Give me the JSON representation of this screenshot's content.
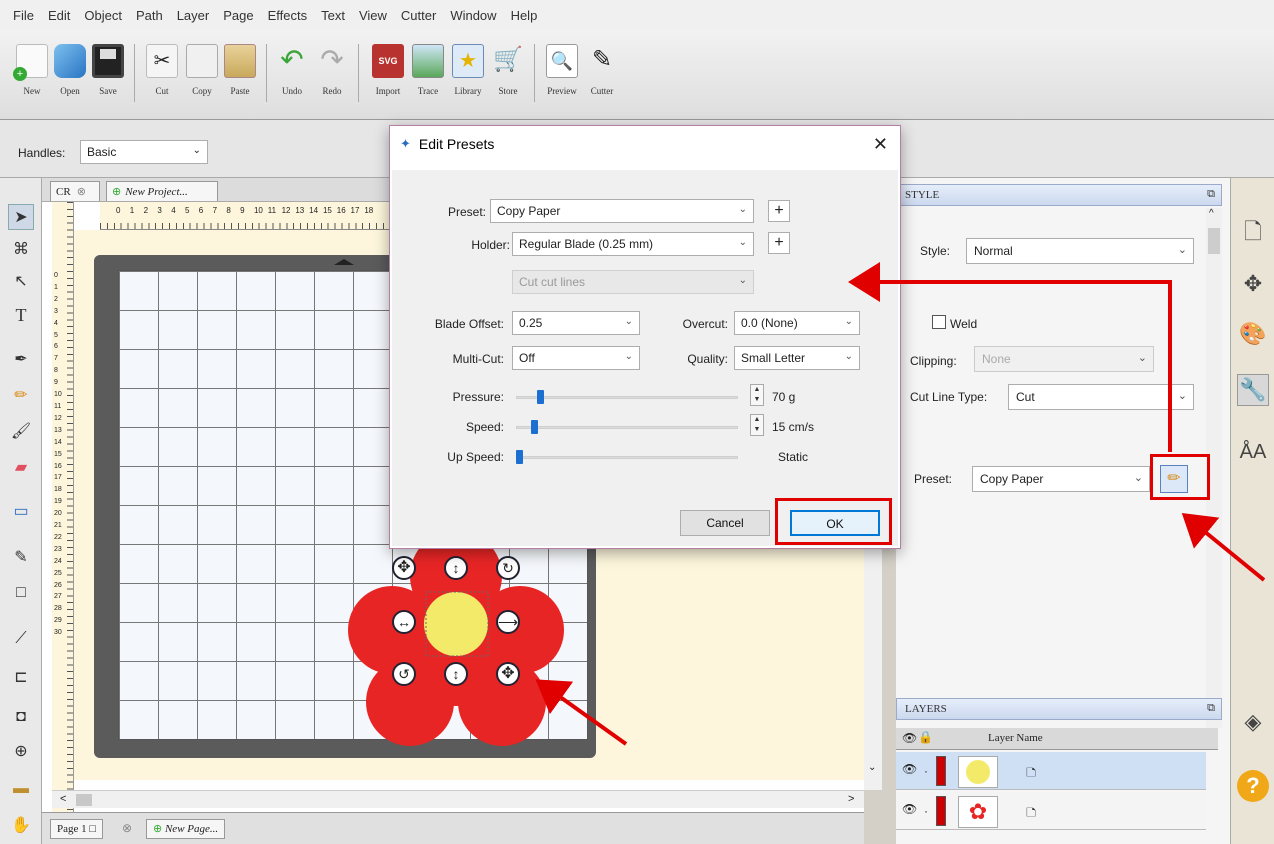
{
  "menu": [
    "File",
    "Edit",
    "Object",
    "Path",
    "Layer",
    "Page",
    "Effects",
    "Text",
    "View",
    "Cutter",
    "Window",
    "Help"
  ],
  "toolbar": {
    "new": "New",
    "open": "Open",
    "save": "Save",
    "cut": "Cut",
    "copy": "Copy",
    "paste": "Paste",
    "undo": "Undo",
    "redo": "Redo",
    "import": "Import",
    "trace": "Trace",
    "library": "Library",
    "store": "Store",
    "preview": "Preview",
    "cutter": "Cutter"
  },
  "handles": {
    "label": "Handles:",
    "value": "Basic"
  },
  "tabs": {
    "cr": "CR",
    "new_project": "New Project..."
  },
  "ruler_numbers": [
    "0",
    "1",
    "2",
    "3",
    "4",
    "5",
    "6",
    "7",
    "8",
    "9",
    "10",
    "11",
    "12",
    "13",
    "14",
    "15",
    "16",
    "17",
    "18"
  ],
  "left_ruler_numbers": [
    "0",
    "1",
    "2",
    "3",
    "4",
    "5",
    "6",
    "7",
    "8",
    "9",
    "10",
    "11",
    "12",
    "13",
    "14",
    "15",
    "16",
    "17",
    "18",
    "19",
    "20",
    "21",
    "22",
    "23",
    "24",
    "25",
    "26",
    "27",
    "28",
    "29",
    "30"
  ],
  "pagebar": {
    "page1": "Page 1",
    "new_page": "New Page..."
  },
  "dialog": {
    "title": "Edit Presets",
    "preset_label": "Preset:",
    "preset_value": "Copy Paper",
    "holder_label": "Holder:",
    "holder_value": "Regular Blade (0.25 mm)",
    "cutlines_value": "Cut cut lines",
    "blade_offset_label": "Blade Offset:",
    "blade_offset_value": "0.25",
    "overcut_label": "Overcut:",
    "overcut_value": "0.0 (None)",
    "multicut_label": "Multi-Cut:",
    "multicut_value": "Off",
    "quality_label": "Quality:",
    "quality_value": "Small Letter",
    "pressure_label": "Pressure:",
    "pressure_value": "70 g",
    "pressure_level": 0.1,
    "speed_label": "Speed:",
    "speed_value": "15 cm/s",
    "speed_level": 0.07,
    "upspeed_label": "Up Speed:",
    "upspeed_value": "Static",
    "upspeed_level": 0.0,
    "cancel": "Cancel",
    "ok": "OK"
  },
  "style_panel": {
    "title": "STYLE",
    "style_label": "Style:",
    "style_value": "Normal",
    "weld_label": "Weld",
    "clipping_label": "Clipping:",
    "clipping_value": "None",
    "cutline_label": "Cut Line Type:",
    "cutline_value": "Cut",
    "preset_label": "Preset:",
    "preset_value": "Copy Paper"
  },
  "layers_panel": {
    "title": "LAYERS",
    "column": "Layer Name"
  },
  "colors": {
    "highlight": "#e00000",
    "flower": "#e82525",
    "center": "#f4ea6a",
    "slider": "#1a6fd1"
  }
}
